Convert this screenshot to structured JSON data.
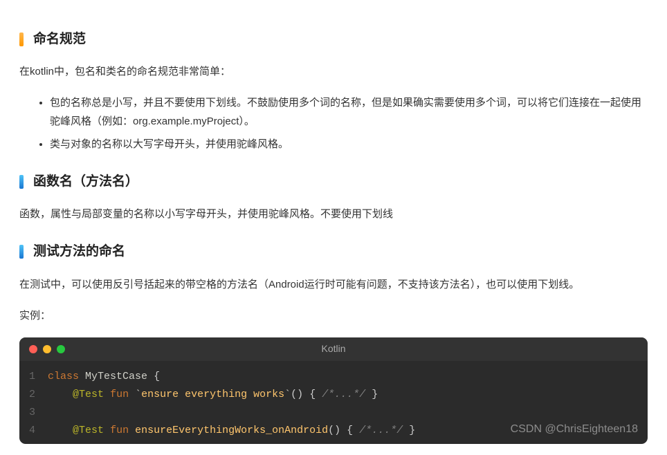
{
  "sections": {
    "naming": {
      "title": "命名规范",
      "intro": "在kotlin中，包名和类名的命名规范非常简单：",
      "bullets": [
        "包的名称总是小写，并且不要使用下划线。不鼓励使用多个词的名称，但是如果确实需要使用多个词，可以将它们连接在一起使用驼峰风格（例如：org.example.myProject）。",
        "类与对象的名称以大写字母开头，并使用驼峰风格。"
      ]
    },
    "functions": {
      "title": "函数名（方法名）",
      "body": "函数，属性与局部变量的名称以小写字母开头，并使用驼峰风格。不要使用下划线"
    },
    "tests": {
      "title": "测试方法的命名",
      "body": "在测试中，可以使用反引号括起来的带空格的方法名（Android运行时可能有问题，不支持该方法名），也可以使用下划线。",
      "example_label": "实例："
    }
  },
  "code": {
    "language": "Kotlin",
    "line_numbers": [
      "1",
      "2",
      "3",
      "4"
    ],
    "tokens": {
      "class_kw": "class",
      "class_name": "MyTestCase",
      "brace_open": "{",
      "annotation": "@Test",
      "fun_kw": "fun",
      "backtick": "`",
      "method1": "ensure everything works",
      "method2": "ensureEverythingWorks_onAndroid",
      "parens": "()",
      "body": "{ ",
      "comment": "/*...*/",
      "body_end": " }"
    }
  },
  "watermark": "CSDN @ChrisEighteen18"
}
